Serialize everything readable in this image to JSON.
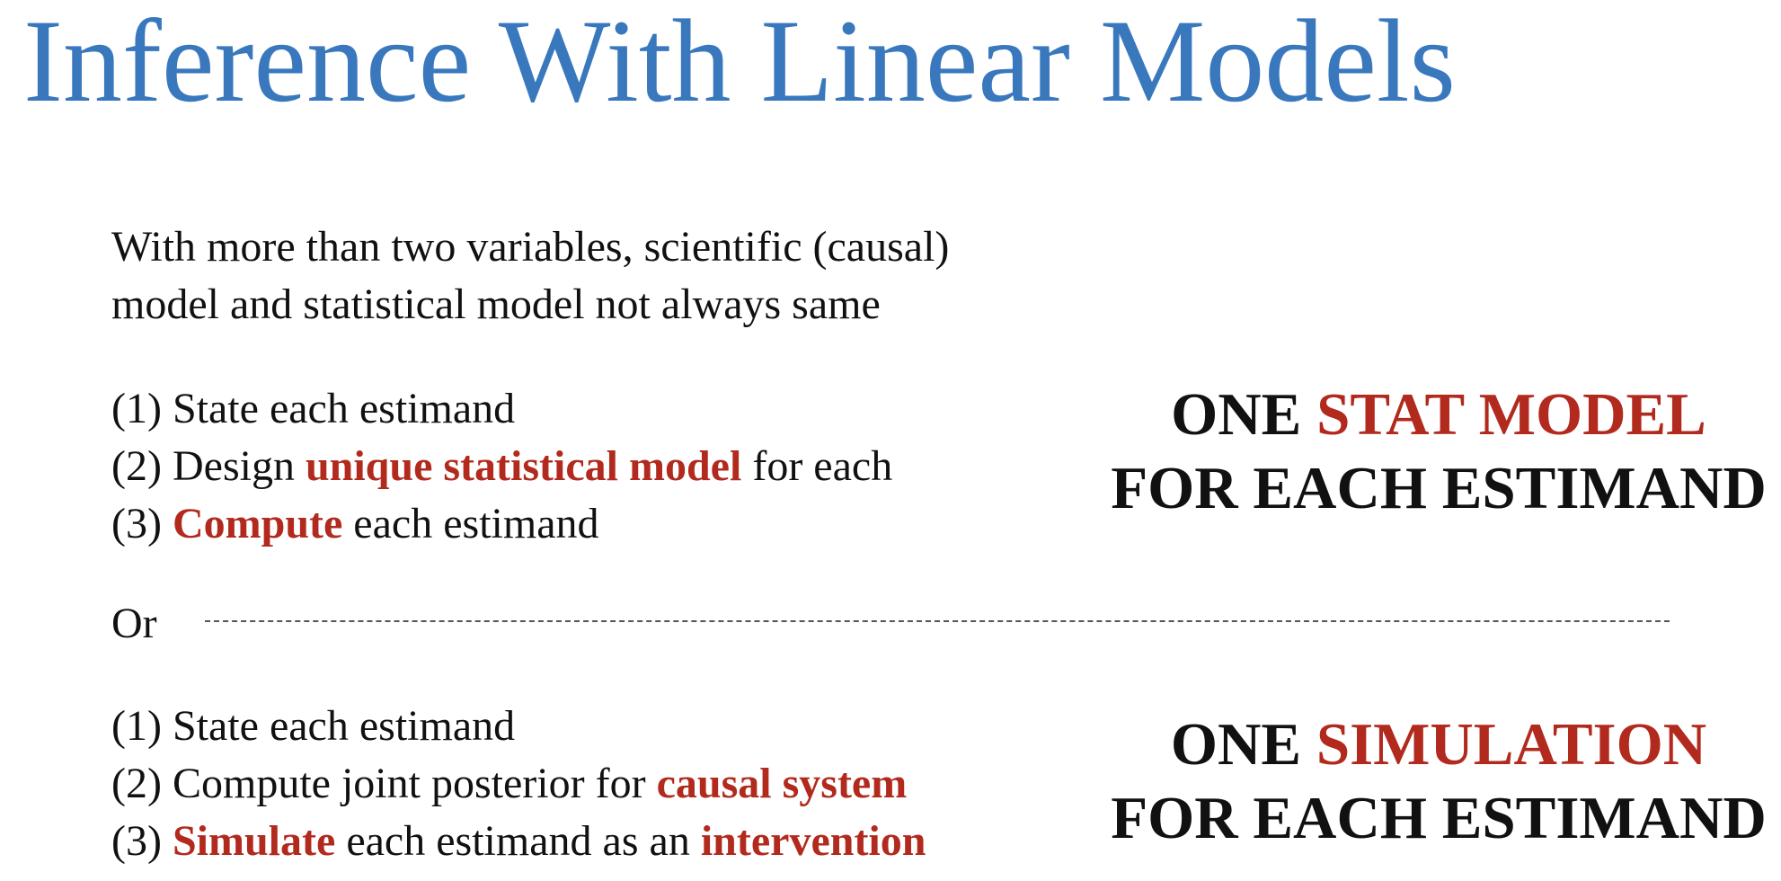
{
  "title": "Inference With Linear Models",
  "intro": {
    "line1": "With more than two variables, scientific (causal)",
    "line2": "model and statistical model not always same"
  },
  "approach1": {
    "step1": "(1) State each estimand",
    "step2_prefix": "(2) Design ",
    "step2_highlight": "unique statistical model",
    "step2_suffix": " for each",
    "step3_prefix": "(3) ",
    "step3_highlight": "Compute",
    "step3_suffix": " each estimand"
  },
  "or_label": "Or",
  "approach2": {
    "step1": "(1) State each estimand",
    "step2_prefix": "(2) Compute joint posterior for ",
    "step2_highlight": "causal system",
    "step3_prefix": "(3) ",
    "step3_highlight": "Simulate",
    "step3_middle": " each estimand as an ",
    "step3_highlight2": "intervention"
  },
  "callout1": {
    "prefix": "ONE ",
    "highlight": "STAT MODEL",
    "line2": "FOR EACH ESTIMAND"
  },
  "callout2": {
    "prefix": "ONE ",
    "highlight": "SIMULATION",
    "line2": "FOR EACH ESTIMAND"
  },
  "colors": {
    "title": "#3a78be",
    "highlight": "#b22a1e",
    "text": "#111111"
  }
}
